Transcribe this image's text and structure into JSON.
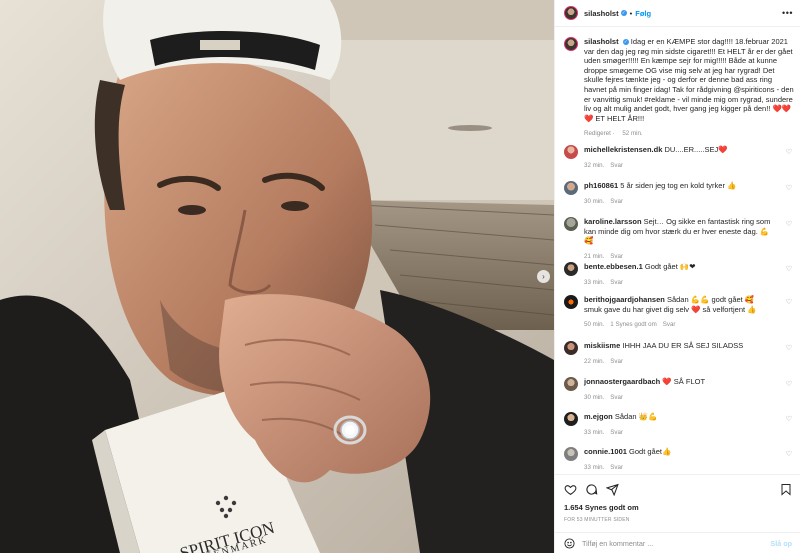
{
  "photo": {
    "product_brand": "SPIRIT ICON",
    "product_sub": "DENMARK",
    "next_icon": "chevron-right-icon"
  },
  "header": {
    "username": "silasholst",
    "separator": "•",
    "follow_label": "Følg",
    "more_icon": "more-horizontal-icon"
  },
  "caption": {
    "username": "silasholst",
    "text": "Idag er en KÆMPE stor dag!!!! 18.februar 2021 var den dag jeg røg min sidste cigaret!!! Et HELT år er der gået uden smøger!!!!! En kæmpe sejr for mig!!!!! Både at kunne droppe smøgerne OG vise mig selv at jeg har rygrad! Det skulle fejres tænkte jeg - og derfor er denne bad ass ring havnet på min finger idag! Tak for rådgivning @spiriticons - den er vanvittig smuk! #reklame - vil minde mig om rygrad, sundere liv og alt mulig andet godt, hver gang jeg kigger på den!! ❤️❤️❤️ ET HELT ÅR!!!",
    "edited": "Redigeret",
    "time": "52 min."
  },
  "comments": [
    {
      "username": "michellekristensen.dk",
      "text": "DU....ER.....SEJ❤️",
      "time": "32 min.",
      "likes": "",
      "reply": "Svar"
    },
    {
      "username": "ph160861",
      "text": "5 år siden jeg tog en kold tyrker 👍",
      "time": "30 min.",
      "likes": "",
      "reply": "Svar"
    },
    {
      "username": "karoline.larsson",
      "text": "Sejt… Og sikke en fantastisk ring som kan minde dig om hvor stærk du er hver eneste dag. 💪🥰",
      "time": "21 min.",
      "likes": "",
      "reply": "Svar"
    },
    {
      "username": "bente.ebbesen.1",
      "text": "Godt gået 🙌❤",
      "time": "33 min.",
      "likes": "",
      "reply": "Svar"
    },
    {
      "username": "berithojgaardjohansen",
      "text": "Sådan 💪💪 godt gået 🥰 smuk gave du har givet dig selv ❤️ så velfortjent 👍",
      "time": "50 min.",
      "likes": "1 Synes godt om",
      "reply": "Svar"
    },
    {
      "username": "miskiisme",
      "text": "IHHH JAA DU ER SÅ SEJ SILADSS",
      "time": "22 min.",
      "likes": "",
      "reply": "Svar"
    },
    {
      "username": "jonnaostergaardbach",
      "text": "❤️ SÅ FLOT",
      "time": "30 min.",
      "likes": "",
      "reply": "Svar"
    },
    {
      "username": "m.ejgon",
      "text": "Sådan 👑💪",
      "time": "33 min.",
      "likes": "",
      "reply": "Svar"
    },
    {
      "username": "connie.1001",
      "text": "Godt gået👍",
      "time": "33 min.",
      "likes": "",
      "reply": "Svar"
    }
  ],
  "actions": {
    "likes": "1.654 Synes godt om",
    "time_ago": "FOR 53 MINUTTER SIDEN",
    "icons": [
      "heart-icon",
      "comment-icon",
      "share-icon",
      "bookmark-icon"
    ]
  },
  "add_comment": {
    "placeholder": "Tilføj en kommentar ...",
    "post_label": "Slå op",
    "emoji_icon": "emoji-icon"
  }
}
